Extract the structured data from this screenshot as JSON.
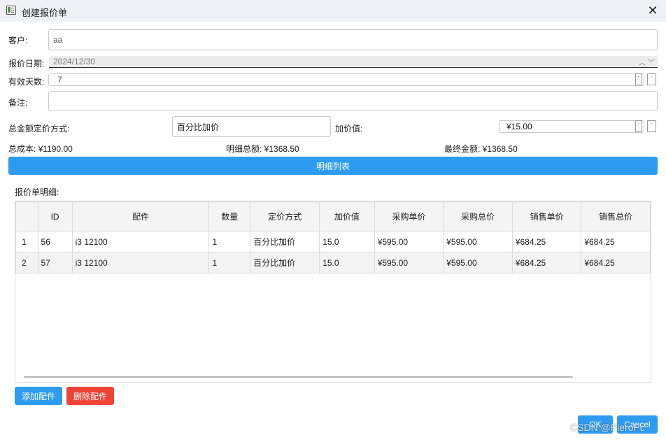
{
  "window": {
    "title": "创建报价单",
    "close_glyph": "✕"
  },
  "form": {
    "customer_label": "客户:",
    "customer_value": "aa",
    "date_label": "报价日期:",
    "date_value": "2024/12/30",
    "valid_days_label": "有效天数:",
    "valid_days_value": "7",
    "note_label": "备注:",
    "note_value": "",
    "pricing_method_label": "总金额定价方式:",
    "pricing_method_value": "百分比加价",
    "markup_label": "加价值:",
    "markup_value": "¥15.00",
    "spin_up": "˙",
    "spin_down": "˙"
  },
  "summary": {
    "total_cost": "总成本: ¥1190.00",
    "detail_total": "明细总额: ¥1368.50",
    "final_amount": "最终金额: ¥1368.50"
  },
  "detail_list_button": "明细列表",
  "details_label": "报价单明细:",
  "table": {
    "columns": [
      "",
      "ID",
      "配件",
      "数量",
      "定价方式",
      "加价值",
      "采购单价",
      "采购总价",
      "销售单价",
      "销售总价"
    ],
    "rows": [
      [
        "1",
        "56",
        "i3 12100",
        "1",
        "百分比加价",
        "15.0",
        "¥595.00",
        "¥595.00",
        "¥684.25",
        "¥684.25"
      ],
      [
        "2",
        "57",
        "i3 12100",
        "1",
        "百分比加价",
        "15.0",
        "¥595.00",
        "¥595.00",
        "¥684.25",
        "¥684.25"
      ]
    ]
  },
  "buttons": {
    "add": "添加配件",
    "delete": "删除配件",
    "ok": "OK",
    "cancel": "Cancel"
  },
  "watermark": "CSDN @PieroPc",
  "colors": {
    "primary": "#2d9cf0",
    "danger": "#ef4336",
    "titlebar": "#eef2f7"
  }
}
